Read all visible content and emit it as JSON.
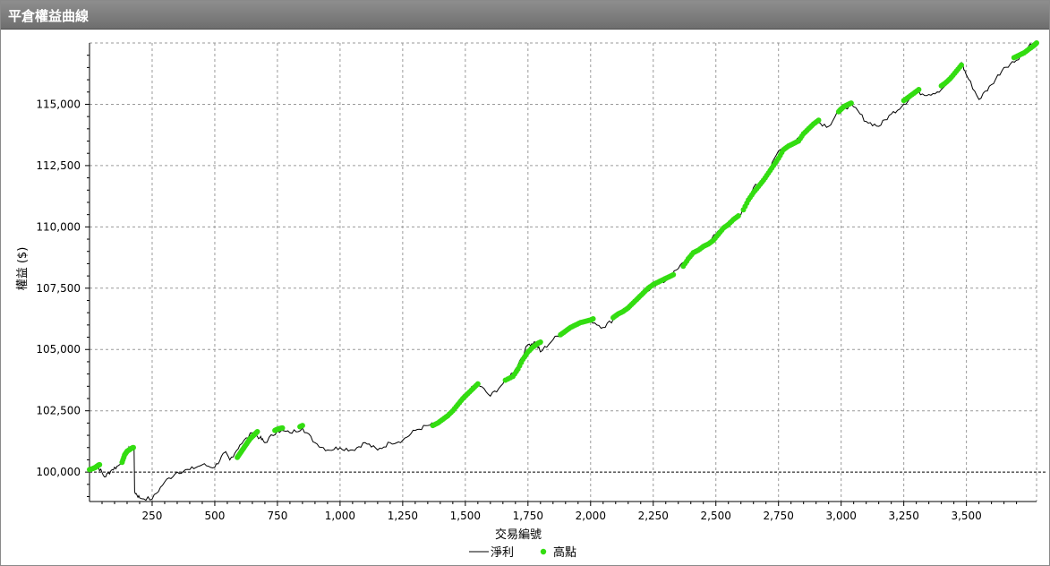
{
  "window": {
    "title": "平倉權益曲線"
  },
  "colors": {
    "line": "#000000",
    "highs": "#33dd11",
    "grid": "#9a9a9a",
    "baseline": "#000000"
  },
  "chart_data": {
    "type": "line",
    "title": "平倉權益曲線",
    "xlabel": "交易編號",
    "ylabel": "權益 ($)",
    "xlim": [
      0,
      3780
    ],
    "ylim": [
      98800,
      117500
    ],
    "baseline": 100000,
    "x_ticks": [
      250,
      500,
      750,
      1000,
      1250,
      1500,
      1750,
      2000,
      2250,
      2500,
      2750,
      3000,
      3250,
      3500
    ],
    "x_tick_labels": [
      "250",
      "500",
      "750",
      "1,000",
      "1,250",
      "1,500",
      "1,750",
      "2,000",
      "2,250",
      "2,500",
      "2,750",
      "3,000",
      "3,250",
      "3,500"
    ],
    "y_ticks": [
      100000,
      102500,
      105000,
      107500,
      110000,
      112500,
      115000
    ],
    "y_tick_labels": [
      "100,000",
      "102,500",
      "105,000",
      "107,500",
      "110,000",
      "112,500",
      "115,000"
    ],
    "grid": true,
    "legend_position": "bottom-center",
    "series": [
      {
        "name": "淨利",
        "style": "line",
        "x": [
          0,
          30,
          60,
          90,
          120,
          150,
          170,
          178,
          180,
          200,
          250,
          300,
          350,
          400,
          450,
          500,
          540,
          560,
          600,
          650,
          680,
          700,
          750,
          800,
          850,
          900,
          950,
          1000,
          1050,
          1100,
          1150,
          1200,
          1250,
          1300,
          1350,
          1400,
          1450,
          1500,
          1550,
          1600,
          1650,
          1700,
          1750,
          1780,
          1800,
          1850,
          1900,
          1950,
          2000,
          2050,
          2100,
          2150,
          2200,
          2250,
          2300,
          2350,
          2400,
          2450,
          2500,
          2550,
          2600,
          2650,
          2700,
          2750,
          2800,
          2850,
          2900,
          2950,
          3000,
          3050,
          3100,
          3150,
          3200,
          3250,
          3300,
          3350,
          3400,
          3450,
          3480,
          3500,
          3550,
          3600,
          3650,
          3700,
          3750,
          3780
        ],
        "y": [
          100100,
          100300,
          99800,
          100100,
          100300,
          100900,
          101000,
          100900,
          99200,
          98950,
          98900,
          99600,
          100000,
          100100,
          100300,
          100200,
          100800,
          100500,
          101100,
          101600,
          101400,
          101200,
          101700,
          101600,
          101800,
          101200,
          100900,
          101000,
          100900,
          101200,
          100900,
          101200,
          101300,
          101700,
          101900,
          102000,
          102500,
          103200,
          103600,
          103100,
          103600,
          104200,
          105200,
          105300,
          104900,
          105400,
          105800,
          106100,
          106200,
          105900,
          106300,
          106700,
          107200,
          107600,
          107800,
          108300,
          108900,
          109200,
          109700,
          110200,
          110500,
          111600,
          112000,
          113100,
          113400,
          113800,
          114300,
          114100,
          114900,
          114900,
          114300,
          114100,
          114600,
          115000,
          115500,
          115400,
          115600,
          116200,
          116700,
          116200,
          115200,
          115800,
          116500,
          116800,
          117400,
          117500
        ]
      },
      {
        "name": "高點",
        "style": "scatter",
        "segments": [
          {
            "x": [
              0,
              15,
              25,
              35,
              40
            ],
            "y": [
              100100,
              100150,
              100200,
              100280,
              100300
            ]
          },
          {
            "x": [
              130,
              140,
              150,
              160,
              170,
              175
            ],
            "y": [
              100400,
              100700,
              100850,
              100920,
              100980,
              101000
            ]
          },
          {
            "x": [
              590,
              600,
              610,
              620,
              630,
              640,
              650,
              660,
              670
            ],
            "y": [
              100600,
              100750,
              100900,
              101050,
              101200,
              101350,
              101450,
              101550,
              101650
            ]
          },
          {
            "x": [
              740,
              750,
              760,
              770
            ],
            "y": [
              101700,
              101750,
              101780,
              101800
            ]
          },
          {
            "x": [
              840,
              850
            ],
            "y": [
              101850,
              101900
            ]
          },
          {
            "x": [
              1370,
              1390,
              1410,
              1430,
              1450,
              1470,
              1490,
              1510,
              1530,
              1550
            ],
            "y": [
              101900,
              102000,
              102150,
              102300,
              102500,
              102750,
              103000,
              103200,
              103400,
              103600
            ]
          },
          {
            "x": [
              1660,
              1690,
              1710,
              1730,
              1750,
              1770,
              1790,
              1800
            ],
            "y": [
              103750,
              103900,
              104200,
              104600,
              104900,
              105100,
              105250,
              105300
            ]
          },
          {
            "x": [
              1880,
              1900,
              1920,
              1940,
              1960,
              1980,
              2000,
              2010
            ],
            "y": [
              105600,
              105750,
              105900,
              106000,
              106100,
              106150,
              106200,
              106250
            ]
          },
          {
            "x": [
              2090,
              2110,
              2130,
              2150,
              2170,
              2190,
              2210,
              2230,
              2250,
              2270,
              2290,
              2310,
              2330
            ],
            "y": [
              106300,
              106450,
              106550,
              106700,
              106900,
              107100,
              107300,
              107500,
              107650,
              107750,
              107850,
              107950,
              108050
            ]
          },
          {
            "x": [
              2370,
              2390,
              2410,
              2430,
              2450,
              2470,
              2490,
              2510,
              2530,
              2550,
              2570,
              2590
            ],
            "y": [
              108400,
              108700,
              108950,
              109050,
              109200,
              109300,
              109450,
              109700,
              109950,
              110100,
              110300,
              110450
            ]
          },
          {
            "x": [
              2610,
              2630,
              2650,
              2670,
              2690,
              2710,
              2730,
              2750,
              2770,
              2790,
              2810,
              2830,
              2850,
              2870,
              2890,
              2910
            ],
            "y": [
              110700,
              111100,
              111400,
              111650,
              111900,
              112200,
              112500,
              112800,
              113150,
              113300,
              113400,
              113500,
              113800,
              114000,
              114200,
              114350
            ]
          },
          {
            "x": [
              2990,
              3000,
              3010,
              3020,
              3030,
              3040
            ],
            "y": [
              114700,
              114800,
              114900,
              114950,
              115000,
              115050
            ]
          },
          {
            "x": [
              3250,
              3270,
              3290,
              3310
            ],
            "y": [
              115150,
              115300,
              115450,
              115600
            ]
          },
          {
            "x": [
              3400,
              3420,
              3440,
              3460,
              3480
            ],
            "y": [
              115750,
              115900,
              116100,
              116350,
              116600
            ]
          },
          {
            "x": [
              3690,
              3710,
              3730,
              3750,
              3770,
              3780
            ],
            "y": [
              116900,
              117000,
              117100,
              117250,
              117400,
              117500
            ]
          }
        ]
      }
    ]
  }
}
